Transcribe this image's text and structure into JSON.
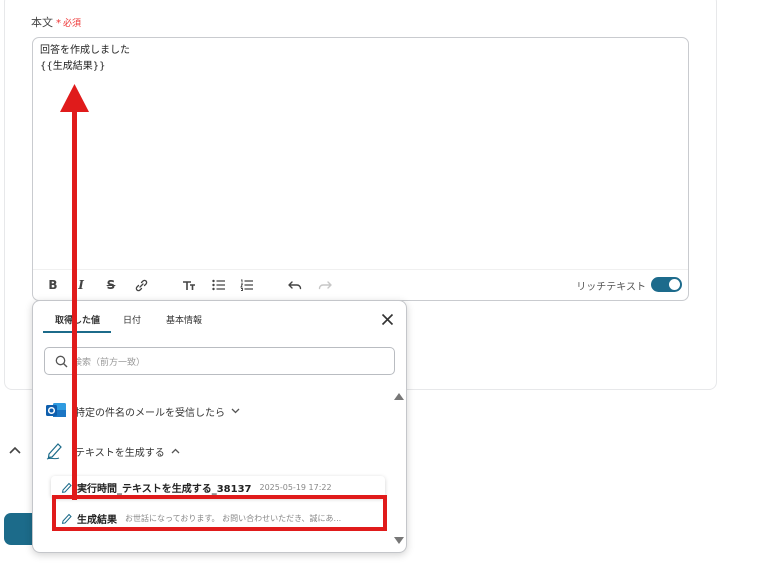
{
  "field": {
    "label": "本文",
    "required_mark": "*",
    "required_text": "必須"
  },
  "editor": {
    "line1": "回答を作成しました",
    "line2": "{{生成結果}}",
    "rich_text_label": "リッチテキスト",
    "rich_text_enabled": true,
    "toolbar_icons": [
      "bold-icon",
      "italic-icon",
      "strikethrough-icon",
      "link-icon",
      "text-size-icon",
      "bullet-list-icon",
      "numbered-list-icon",
      "undo-icon",
      "redo-icon"
    ]
  },
  "popup": {
    "tabs": [
      {
        "label": "取得した値",
        "active": true
      },
      {
        "label": "日付",
        "active": false
      },
      {
        "label": "基本情報",
        "active": false
      }
    ],
    "search_placeholder": "検索（前方一致）",
    "groups": [
      {
        "label": "特定の件名のメールを受信したら",
        "icon": "outlook-icon",
        "expanded": false
      },
      {
        "label": "テキストを生成する",
        "icon": "ai-pen-icon",
        "expanded": true
      }
    ],
    "items": [
      {
        "name": "実行時間_テキストを生成する_38137",
        "meta": "2025-05-19 17:22"
      },
      {
        "name": "生成結果",
        "meta": "お世話になっております。 お問い合わせいただき、誠にあ..."
      }
    ]
  },
  "colors": {
    "accent": "#1c6b8a",
    "highlight": "#e01b1b",
    "required": "#e33333"
  }
}
